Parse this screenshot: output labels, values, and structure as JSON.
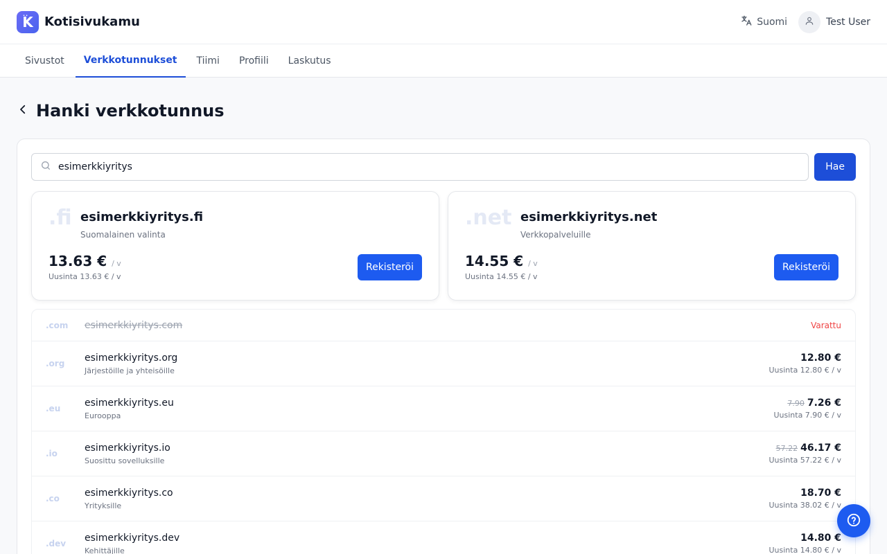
{
  "app": {
    "name": "Kotisivukamu",
    "logo_letter": "K",
    "logo_dots": "··"
  },
  "header": {
    "language": "Suomi",
    "user_name": "Test User"
  },
  "tabs": [
    {
      "label": "Sivustot",
      "active": false
    },
    {
      "label": "Verkkotunnukset",
      "active": true
    },
    {
      "label": "Tiimi",
      "active": false
    },
    {
      "label": "Profiili",
      "active": false
    },
    {
      "label": "Laskutus",
      "active": false
    }
  ],
  "page": {
    "title": "Hanki verkkotunnus"
  },
  "search": {
    "value": "esimerkkiyritys",
    "button_label": "Hae"
  },
  "featured": [
    {
      "tld": ".fi",
      "name": "esimerkkiyritys.fi",
      "description": "Suomalainen valinta",
      "price": "13.63 €",
      "period": "/ v",
      "renew": "Uusinta 13.63 € / v",
      "button_label": "Rekisteröi"
    },
    {
      "tld": ".net",
      "name": "esimerkkiyritys.net",
      "description": "Verkkopalveluille",
      "price": "14.55 €",
      "period": "/ v",
      "renew": "Uusinta 14.55 € / v",
      "button_label": "Rekisteröi"
    }
  ],
  "domains": [
    {
      "tld": ".com",
      "name": "esimerkkiyritys.com",
      "status": "Varattu"
    },
    {
      "tld": ".org",
      "name": "esimerkkiyritys.org",
      "description": "Järjestöille ja yhteisöille",
      "price": "12.80 €",
      "renew": "Uusinta 12.80 € / v"
    },
    {
      "tld": ".eu",
      "name": "esimerkkiyritys.eu",
      "description": "Eurooppa",
      "old_price": "7.90",
      "price": "7.26 €",
      "renew": "Uusinta 7.90 € / v"
    },
    {
      "tld": ".io",
      "name": "esimerkkiyritys.io",
      "description": "Suosittu sovelluksille",
      "old_price": "57.22",
      "price": "46.17 €",
      "renew": "Uusinta 57.22 € / v"
    },
    {
      "tld": ".co",
      "name": "esimerkkiyritys.co",
      "description": "Yrityksille",
      "price": "18.70 €",
      "renew": "Uusinta 38.02 € / v"
    },
    {
      "tld": ".dev",
      "name": "esimerkkiyritys.dev",
      "description": "Kehittäjille",
      "price": "14.80 €",
      "renew": "Uusinta 14.80 € / v"
    }
  ],
  "icons": {
    "language": "translate-icon",
    "user": "user-icon",
    "back": "chevron-left-icon",
    "search": "search-icon",
    "help": "help-circle-icon"
  },
  "colors": {
    "primary": "#1d4ed8",
    "button": "#1d5bf0",
    "taken": "#ef4444"
  }
}
